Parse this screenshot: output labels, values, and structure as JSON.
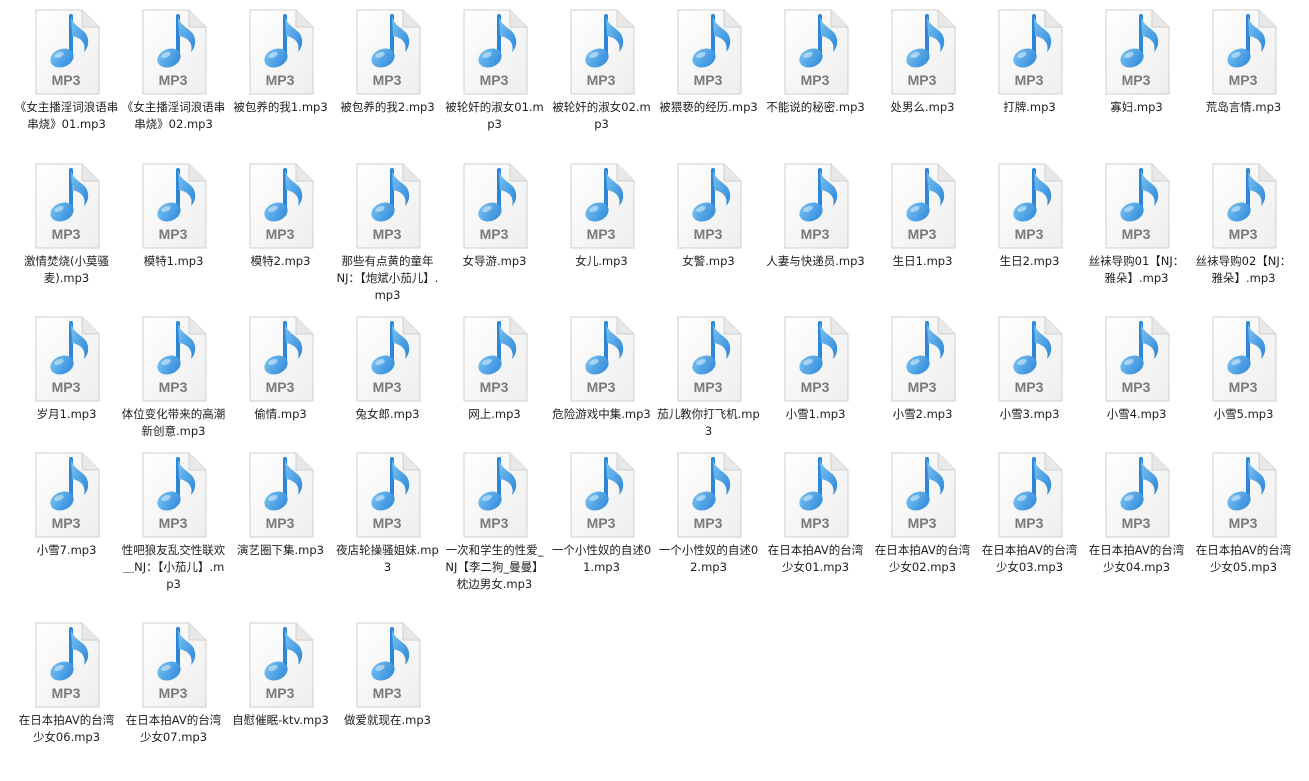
{
  "file_view": {
    "icon": "mp3-audio-file-icon",
    "icon_label": "MP3",
    "colors": {
      "note_blue": "#2b86d8",
      "note_highlight": "#7cc4f4",
      "page_white": "#ffffff",
      "page_border": "#cfcfcf",
      "mp3_label": "#7a7a7a"
    },
    "rows": [
      [
        "《女主播淫词浪语串串烧》01.mp3",
        "《女主播淫词浪语串串烧》02.mp3",
        "被包养的我1.mp3",
        "被包养的我2.mp3",
        "被轮奸的淑女01.mp3",
        "被轮奸的淑女02.mp3",
        "被猥亵的经历.mp3",
        "不能说的秘密.mp3",
        "处男么.mp3",
        "打牌.mp3",
        "寡妇.mp3",
        "荒岛言情.mp3"
      ],
      [
        "激情焚烧(小莫骚麦).mp3",
        "模特1.mp3",
        "模特2.mp3",
        "那些有点黄的童年　NJ：【炮斌小茄儿】.mp3",
        "女导游.mp3",
        "女儿.mp3",
        "女警.mp3",
        "人妻与快递员.mp3",
        "生日1.mp3",
        "生日2.mp3",
        "丝袜导购01【NJ：雅朵】.mp3",
        "丝袜导购02【NJ：雅朵】.mp3"
      ],
      [
        "岁月1.mp3",
        "体位变化带来的高潮新创意.mp3",
        "偷情.mp3",
        "兔女郎.mp3",
        "网上.mp3",
        "危险游戏中集.mp3",
        "茄儿教你打飞机.mp3",
        "小雪1.mp3",
        "小雪2.mp3",
        "小雪3.mp3",
        "小雪4.mp3",
        "小雪5.mp3"
      ],
      [
        "小雪7.mp3",
        "性吧狼友乱交性联欢＿NJ：【小茄儿】.mp3",
        "演艺圈下集.mp3",
        "夜店轮操骚姐妹.mp3",
        "一次和学生的性爱_NJ【李二狗_曼曼】枕边男女.mp3",
        "一个小性奴的自述01.mp3",
        "一个小性奴的自述02.mp3",
        "在日本拍AV的台湾少女01.mp3",
        "在日本拍AV的台湾少女02.mp3",
        "在日本拍AV的台湾少女03.mp3",
        "在日本拍AV的台湾少女04.mp3",
        "在日本拍AV的台湾少女05.mp3"
      ],
      [
        "在日本拍AV的台湾少女06.mp3",
        "在日本拍AV的台湾少女07.mp3",
        "自慰催眠-ktv.mp3",
        "做爱就现在.mp3"
      ]
    ]
  }
}
